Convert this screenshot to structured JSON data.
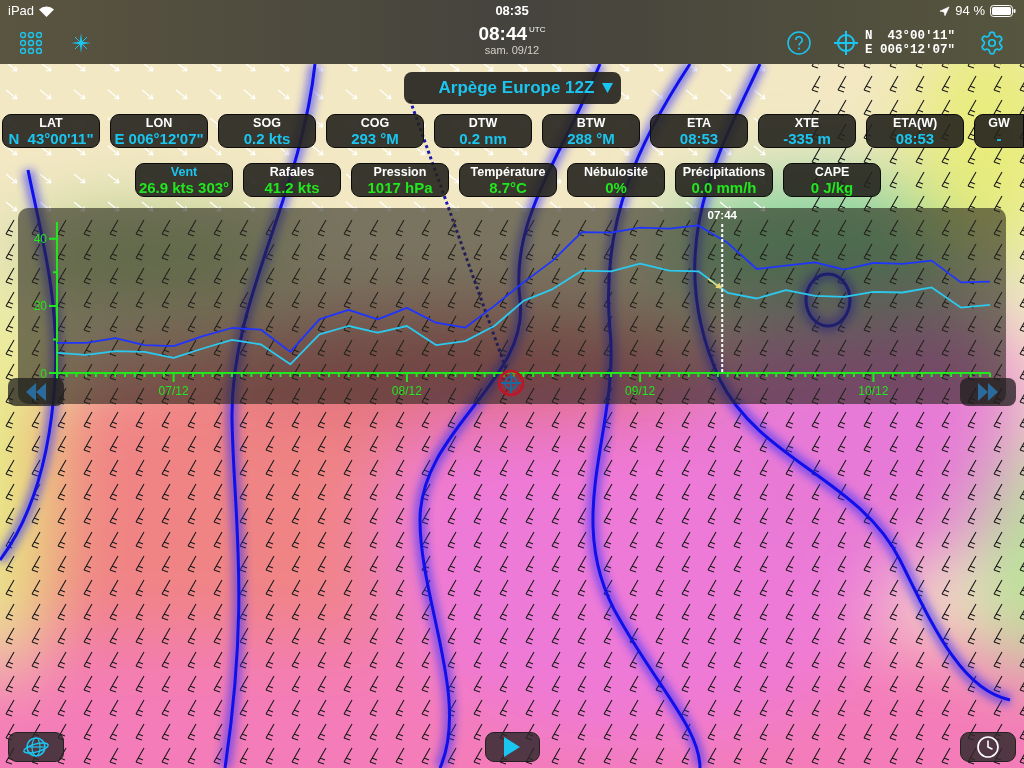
{
  "status_bar": {
    "device": "iPad",
    "time": "08:35",
    "battery": "94 %"
  },
  "toolbar": {
    "time": "08:44",
    "timezone": "UTC",
    "date": "sam. 09/12",
    "latitude": "N  43°00'11\"",
    "longitude": "E 006°12'07\""
  },
  "model_selector": {
    "label": "Arpège Europe 12Z"
  },
  "navigation": [
    {
      "label": "LAT",
      "value": "N  43°00'11\""
    },
    {
      "label": "LON",
      "value": "E 006°12'07\""
    },
    {
      "label": "SOG",
      "value": "0.2 kts"
    },
    {
      "label": "COG",
      "value": "293 °M"
    },
    {
      "label": "DTW",
      "value": "0.2 nm"
    },
    {
      "label": "BTW",
      "value": "288 °M"
    },
    {
      "label": "ETA",
      "value": "08:53"
    },
    {
      "label": "XTE",
      "value": "-335 m"
    },
    {
      "label": "ETA(W)",
      "value": "08:53"
    },
    {
      "label": "GW",
      "value": "-"
    }
  ],
  "weather": [
    {
      "label": "Vent",
      "value": "26.9 kts 303°",
      "selected": true
    },
    {
      "label": "Rafales",
      "value": "41.2 kts",
      "selected": false
    },
    {
      "label": "Pression",
      "value": "1017 hPa",
      "selected": false
    },
    {
      "label": "Température",
      "value": "8.7°C",
      "selected": false
    },
    {
      "label": "Nébulosité",
      "value": "0%",
      "selected": false
    },
    {
      "label": "Précipitations",
      "value": "0.0 mm/h",
      "selected": false
    },
    {
      "label": "CAPE",
      "value": "0 J/kg",
      "selected": false
    }
  ],
  "chart": {
    "cursor": {
      "label": "07:44",
      "level": 0.713
    },
    "chart_data": {
      "type": "line",
      "categories": [
        null,
        null,
        null,
        null,
        "07/12",
        null,
        null,
        null,
        null,
        null,
        null,
        null,
        "08/12",
        null,
        null,
        null,
        null,
        null,
        null,
        null,
        "09/12",
        null,
        null,
        null,
        null,
        null,
        null,
        null,
        "10/12",
        null,
        null,
        null,
        null
      ],
      "series": [
        {
          "color": "#1f35ff",
          "values": [
            9,
            9,
            10.4,
            8.3,
            8,
            11,
            13.4,
            12.9,
            6.3,
            16,
            18.8,
            16,
            19.4,
            15,
            13.5,
            20,
            27,
            33.5,
            42,
            41.8,
            43.3,
            43,
            44,
            38.8,
            31,
            32,
            33,
            30.8,
            32.8,
            32.5,
            33.5,
            27,
            27.2
          ]
        },
        {
          "color": "#2cc8ee",
          "values": [
            6,
            5.4,
            6.5,
            6.3,
            4.5,
            7.3,
            9.9,
            8.5,
            2.6,
            11.5,
            14,
            12,
            14,
            8.3,
            9.5,
            14,
            21.5,
            25,
            30.5,
            30.3,
            32.6,
            30.5,
            30.3,
            23.9,
            22.2,
            24.7,
            23,
            22.7,
            24.2,
            24,
            25.5,
            19.5,
            20.3
          ]
        }
      ],
      "ylim": [
        0,
        45
      ],
      "yticks": [
        0,
        20,
        40
      ]
    }
  }
}
